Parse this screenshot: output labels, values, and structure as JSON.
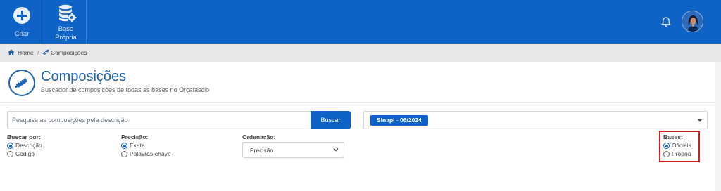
{
  "topbar": {
    "criar_label": "Criar",
    "base_label_line1": "Base",
    "base_label_line2": "Própria"
  },
  "breadcrumb": {
    "home": "Home",
    "separator": "/",
    "current": "Composições"
  },
  "header": {
    "title": "Composições",
    "subtitle": "Buscador de composições de todas as bases no Orçafascio"
  },
  "search": {
    "placeholder": "Pesquisa as composições pela descrição",
    "value": "",
    "button": "Buscar"
  },
  "base_select": {
    "selected_tag": "Sinapi - 06/2024"
  },
  "filters": {
    "buscar_por": {
      "label": "Buscar por:",
      "options": [
        "Descrição",
        "Código"
      ],
      "selected": "Descrição"
    },
    "precisao": {
      "label": "Precisão:",
      "options": [
        "Exata",
        "Palavras-chave"
      ],
      "selected": "Exata"
    },
    "ordenacao": {
      "label": "Ordenação:",
      "selected": "Precisão"
    },
    "bases": {
      "label": "Bases:",
      "options": [
        "Oficiais",
        "Própria"
      ],
      "selected": "Oficiais"
    }
  },
  "icons": {
    "criar": "plus-circle-icon",
    "base": "database-gear-icon",
    "notifications": "bell-icon",
    "home": "home-icon",
    "composicoes": "trowel-icon",
    "header": "trowel-icon"
  },
  "colors": {
    "primary": "#0f63c7",
    "highlight_box": "#d71920",
    "header_text": "#1e64b8"
  }
}
